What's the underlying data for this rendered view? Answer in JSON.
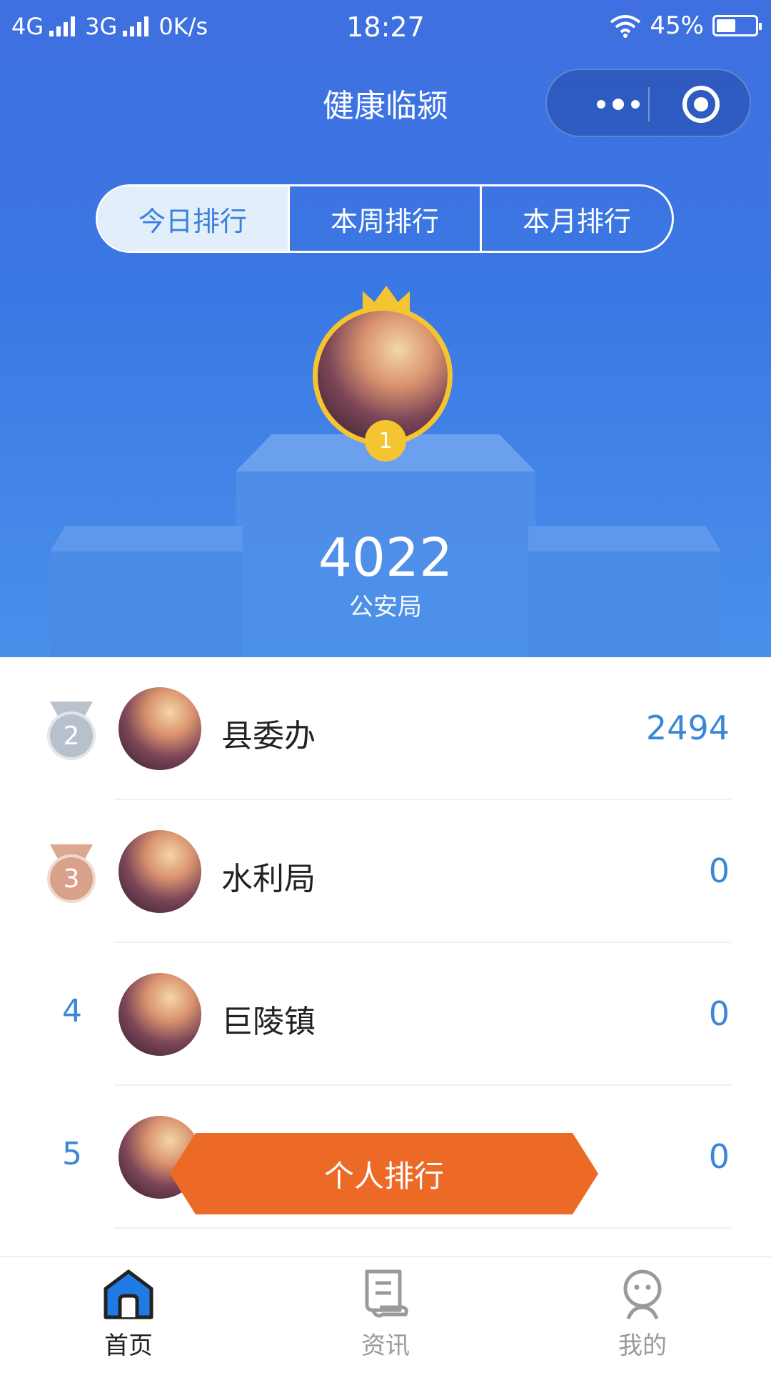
{
  "status_bar": {
    "network1": "4G",
    "network2": "3G",
    "speed": "0K/s",
    "time": "18:27",
    "battery": "45%"
  },
  "nav": {
    "title": "健康临颍"
  },
  "tabs": [
    {
      "label": "今日排行",
      "active": true
    },
    {
      "label": "本周排行",
      "active": false
    },
    {
      "label": "本月排行",
      "active": false
    }
  ],
  "top": {
    "rank": "1",
    "score": "4022",
    "name": "公安局"
  },
  "rows": [
    {
      "rank": "2",
      "name": "县委办",
      "value": "2494"
    },
    {
      "rank": "3",
      "name": "水利局",
      "value": "0"
    },
    {
      "rank": "4",
      "name": "巨陵镇",
      "value": "0"
    },
    {
      "rank": "5",
      "name": "",
      "value": "0"
    }
  ],
  "personal_button": "个人排行",
  "tabbar": [
    {
      "label": "首页",
      "icon": "home-icon",
      "active": true
    },
    {
      "label": "资讯",
      "icon": "news-icon",
      "active": false
    },
    {
      "label": "我的",
      "icon": "profile-icon",
      "active": false
    }
  ],
  "colors": {
    "primary": "#3a78e4",
    "accent": "#ec6a25",
    "gold": "#f5c531",
    "value_blue": "#3a86d8"
  }
}
